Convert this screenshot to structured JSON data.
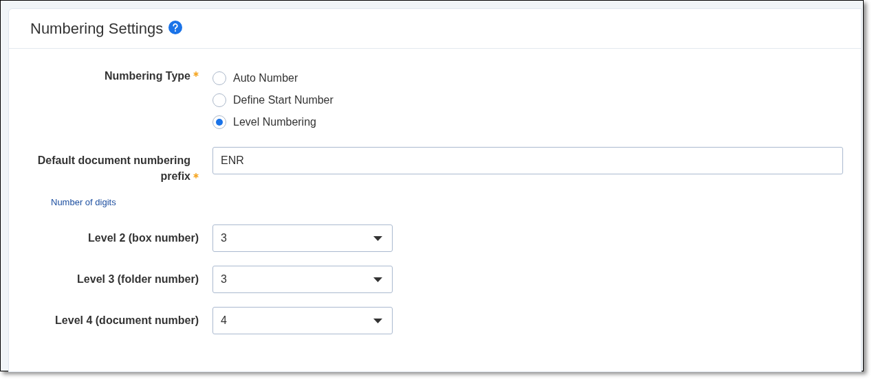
{
  "panel": {
    "title": "Numbering Settings",
    "help": true
  },
  "numbering_type": {
    "label": "Numbering Type",
    "required": true,
    "options": [
      {
        "label": "Auto Number",
        "selected": false
      },
      {
        "label": "Define Start Number",
        "selected": false
      },
      {
        "label": "Level Numbering",
        "selected": true
      }
    ]
  },
  "prefix": {
    "label_lines": [
      "Default document numbering",
      "prefix"
    ],
    "required": true,
    "value": "ENR"
  },
  "digits_heading": "Number of digits",
  "levels": [
    {
      "label": "Level 2 (box number)",
      "value": "3"
    },
    {
      "label": "Level 3 (folder number)",
      "value": "3"
    },
    {
      "label": "Level 4 (document number)",
      "value": "4"
    }
  ]
}
